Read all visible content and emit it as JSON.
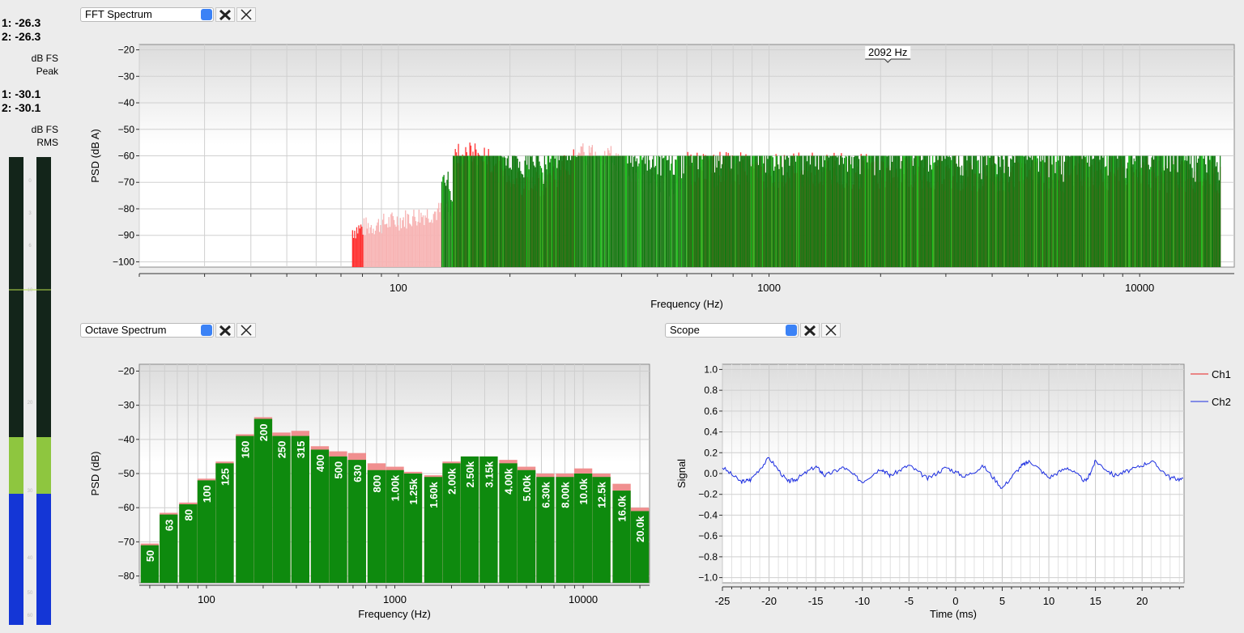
{
  "levels": {
    "peak": {
      "ch1": "1: -26.3",
      "ch2": "2: -26.3",
      "unit": "dB FS",
      "kind": "Peak"
    },
    "rms": {
      "ch1": "1: -30.1",
      "ch2": "2: -30.1",
      "unit": "dB FS",
      "kind": "RMS"
    },
    "meter_scale": [
      "0",
      "3",
      "6",
      "10",
      "20",
      "30",
      "40",
      "50",
      "60"
    ],
    "meter_levels": {
      "ch1_rms": -30.1,
      "ch2_rms": -30.1
    },
    "colors": {
      "meter_bg": "#13251a",
      "meter_green": "#8ec63f",
      "meter_blue": "#1436d6"
    }
  },
  "panels": {
    "fft": {
      "selector": "FFT Spectrum",
      "tools_icon": "tools-icon",
      "close_icon": "close-icon"
    },
    "octave": {
      "selector": "Octave Spectrum",
      "tools_icon": "tools-icon",
      "close_icon": "close-icon"
    },
    "scope": {
      "selector": "Scope",
      "tools_icon": "tools-icon",
      "close_icon": "close-icon"
    }
  },
  "chart_data": [
    {
      "id": "fft",
      "type": "bar",
      "xlabel": "Frequency (Hz)",
      "ylabel": "PSD (dB A)",
      "xscale": "log",
      "xlim": [
        20,
        18000
      ],
      "ylim": [
        -102,
        -18
      ],
      "yticks": [
        -20,
        -30,
        -40,
        -50,
        -60,
        -70,
        -80,
        -90,
        -100
      ],
      "xticks": [
        100,
        1000,
        10000
      ],
      "xtick_labels": [
        "100",
        "1000",
        "10000"
      ],
      "cursor_label": "2092 Hz",
      "cursor_freq": 2092,
      "series": [
        {
          "color": "#ff3b3b",
          "kind": "ch1-peak"
        },
        {
          "color": "#1a9a1a",
          "kind": "ch2-peak"
        }
      ]
    },
    {
      "id": "octave",
      "type": "bar",
      "xlabel": "Frequency (Hz)",
      "ylabel": "PSD (dB)",
      "xscale": "log",
      "ylim": [
        -82,
        -18
      ],
      "yticks": [
        -20,
        -30,
        -40,
        -50,
        -60,
        -70,
        -80
      ],
      "xticks": [
        100,
        1000,
        10000
      ],
      "xtick_labels": [
        "100",
        "1000",
        "10000"
      ],
      "categories": [
        "50",
        "63",
        "80",
        "100",
        "125",
        "160",
        "200",
        "250",
        "315",
        "400",
        "500",
        "630",
        "800",
        "1.00k",
        "1.25k",
        "1.60k",
        "2.00k",
        "2.50k",
        "3.15k",
        "4.00k",
        "5.00k",
        "6.30k",
        "8.00k",
        "10.0k",
        "12.5k",
        "16.0k",
        "20.0k"
      ],
      "centers": [
        50,
        63,
        80,
        100,
        125,
        160,
        200,
        250,
        315,
        400,
        500,
        630,
        800,
        1000,
        1250,
        1600,
        2000,
        2500,
        3150,
        4000,
        5000,
        6300,
        8000,
        10000,
        12500,
        16000,
        20000
      ],
      "series": [
        {
          "color": "#0e8a0e",
          "values": [
            -71,
            -62,
            -59,
            -52,
            -47,
            -39,
            -34,
            -39,
            -39,
            -43,
            -45,
            -46,
            -49,
            -49,
            -50,
            -51,
            -47,
            -45,
            -45,
            -47,
            -49,
            -51,
            -51,
            -50,
            -51,
            -55,
            -61
          ]
        },
        {
          "color": "#f08f8f",
          "values": [
            -70.5,
            -61.5,
            -58.5,
            -51.5,
            -46.5,
            -38.5,
            -33.5,
            -38,
            -37.5,
            -42,
            -43.5,
            -44,
            -47,
            -48,
            -49.5,
            -50.5,
            -46.5,
            -45,
            -45,
            -46,
            -48,
            -50,
            -50,
            -48.5,
            -50,
            -53,
            -60
          ]
        }
      ]
    },
    {
      "id": "scope",
      "type": "line",
      "xlabel": "Time (ms)",
      "ylabel": "Signal",
      "xlim": [
        -25,
        24.5
      ],
      "ylim": [
        -1.05,
        1.05
      ],
      "xticks": [
        -25,
        -20,
        -15,
        -10,
        -5,
        0,
        5,
        10,
        15,
        20
      ],
      "xtick_labels": [
        "-25",
        "-20",
        "-15",
        "-10",
        "-5",
        "0",
        "5",
        "10",
        "15",
        "20"
      ],
      "yticks": [
        1.0,
        0.8,
        0.6,
        0.4,
        0.2,
        0.0,
        -0.2,
        -0.4,
        -0.6,
        -0.8,
        -1.0
      ],
      "ytick_labels": [
        "1.0",
        "0.8",
        "0.6",
        "0.4",
        "0.2",
        "0.0",
        "−0.2",
        "−0.4",
        "−0.6",
        "−0.8",
        "−1.0"
      ],
      "legend": [
        {
          "name": "Ch1",
          "color": "#e8201f"
        },
        {
          "name": "Ch2",
          "color": "#1a2ce0"
        }
      ],
      "series": [
        {
          "name": "Ch2",
          "color": "#1a2ce0",
          "x": [
            -25,
            -23,
            -22,
            -20,
            -18,
            -17,
            -15,
            -14,
            -12,
            -10,
            -8,
            -7,
            -5,
            -3,
            -1,
            1,
            3,
            5,
            7,
            8,
            10,
            12,
            14,
            15,
            17,
            19,
            21,
            23,
            24.5
          ],
          "y": [
            0.06,
            -0.08,
            -0.06,
            0.15,
            -0.08,
            -0.05,
            0.07,
            -0.02,
            0.06,
            -0.08,
            0.05,
            -0.02,
            0.08,
            -0.05,
            0.06,
            -0.03,
            0.07,
            -0.14,
            0.07,
            0.12,
            -0.04,
            0.06,
            -0.08,
            0.12,
            -0.02,
            0.04,
            0.12,
            -0.04,
            -0.06
          ]
        }
      ]
    }
  ]
}
